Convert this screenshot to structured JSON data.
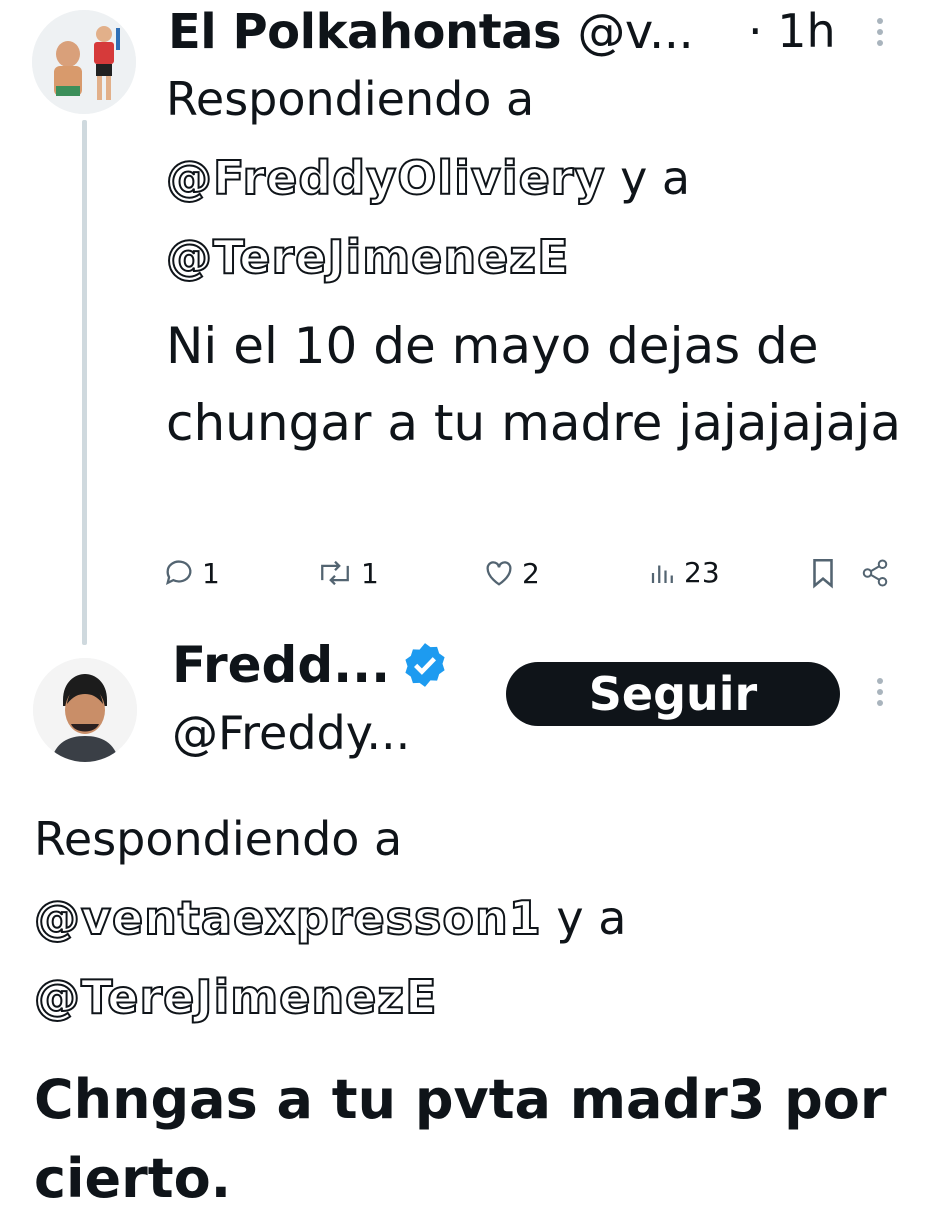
{
  "tweet1": {
    "display_name": "El Polkahontas",
    "handle": "@v...",
    "time": "· 1h",
    "reply_prefix": "Respondiendo a ",
    "mention_a": "@FreddyOliviery",
    "reply_join": " y a ",
    "mention_b": "@TereJimenezE",
    "text": "Ni el 10 de mayo dejas de chungar a tu madre jajajajaja",
    "stats": {
      "replies": "1",
      "reposts": "1",
      "likes": "2",
      "views": "23"
    }
  },
  "tweet2": {
    "display_name": "Fredd...",
    "handle": "@Freddy...",
    "follow_label": "Seguir",
    "reply_prefix": "Respondiendo a ",
    "mention_a": "@ventaexpresson1",
    "reply_join": " y a ",
    "mention_b": "@TereJimenezE",
    "text": "Chngas a tu pvta madr3 por cierto."
  },
  "icons": {
    "reply": "reply-icon",
    "repost": "repost-icon",
    "like": "heart-icon",
    "views": "views-icon",
    "bookmark": "bookmark-icon",
    "share": "share-icon",
    "verified": "verified-badge-icon",
    "more": "more-vertical-icon"
  },
  "colors": {
    "verified": "#1d9bf0",
    "follow_button": "#0f1419",
    "thread_line": "#cfd9de"
  }
}
